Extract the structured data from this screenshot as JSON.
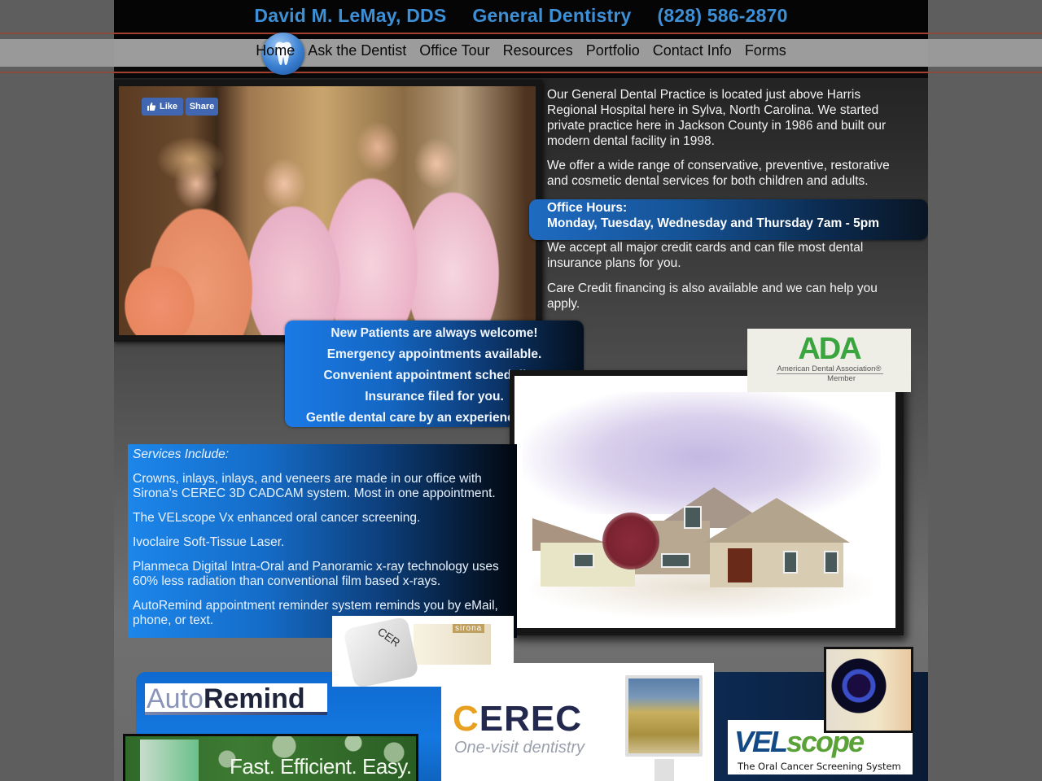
{
  "header": {
    "name": "David M. LeMay, DDS",
    "specialty": "General Dentistry",
    "phone": "(828) 586-2870",
    "accent_color": "#3d8fd6"
  },
  "nav": {
    "logo_icon": "tooth-icon",
    "items": [
      {
        "label": "Home"
      },
      {
        "label": "Ask the Dentist"
      },
      {
        "label": "Office Tour"
      },
      {
        "label": "Resources"
      },
      {
        "label": "Portfolio"
      },
      {
        "label": "Contact Info"
      },
      {
        "label": "Forms"
      }
    ]
  },
  "social": {
    "like_label": "Like",
    "share_label": "Share",
    "like_icon": "thumbs-up-icon"
  },
  "intro": {
    "paragraphs": [
      "Our General Dental Practice is located just above Harris Regional Hospital here in Sylva, North Carolina. We started private practice here in Jackson County in 1986 and built our modern dental facility in 1998.",
      "We offer a wide range of conservative, preventive, restorative and cosmetic dental services for both children and adults."
    ],
    "hours_title": "Office Hours:",
    "hours_value": "Monday, Tuesday, Wednesday and Thursday 7am - 5pm",
    "paragraphs_after": [
      "We accept all major credit cards and can file most dental insurance plans for you.",
      "Care Credit financing is also available and we can help you apply."
    ]
  },
  "welcome": {
    "lines": [
      "New Patients are always welcome!",
      "Emergency appointments available.",
      "Convenient appointment scheduling.",
      "Insurance filed for you.",
      "Gentle dental care by an experienced staff."
    ]
  },
  "ada": {
    "mark": "ADA",
    "name": "American Dental Association®",
    "member": "Member"
  },
  "services": {
    "heading": "Services Include:",
    "items": [
      "Crowns, inlays, inlays, and veneers are made in our office with Sirona's CEREC 3D CADCAM system. Most in one appointment.",
      "The VELscope Vx enhanced oral cancer screening.",
      "Ivoclaire Soft-Tissue Laser.",
      "Planmeca Digital Intra-Oral and Panoramic x-ray technology uses 60% less radiation than conventional film based x-rays.",
      "AutoRemind appointment reminder system reminds you by eMail, phone, or text."
    ]
  },
  "promos": {
    "sirona_brand": "sirona",
    "sirona_block_text": "CER",
    "autoremind_auto": "Auto",
    "autoremind_remind": "Remind",
    "banner_text": "Fast. Efficient. Easy.",
    "cerec_c": "C",
    "cerec_rest": "EREC",
    "cerec_tagline": "One-visit dentistry",
    "velscope_vel": "VEL",
    "velscope_scope": "scope",
    "velscope_tagline": "The Oral Cancer Screening System"
  }
}
